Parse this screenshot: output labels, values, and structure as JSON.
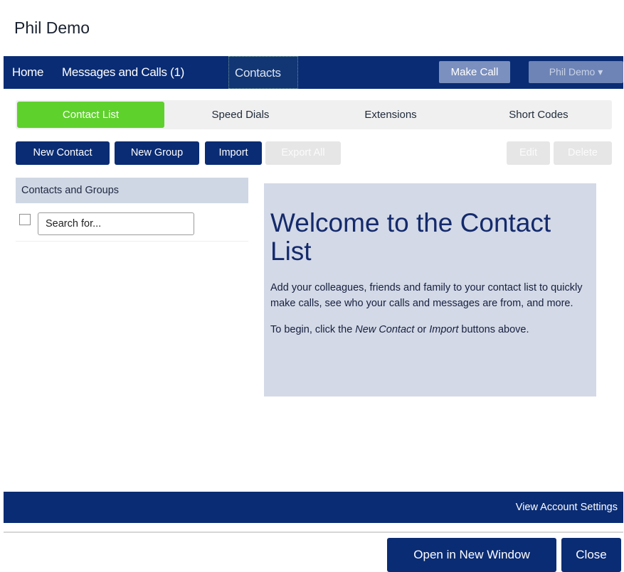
{
  "window": {
    "title": "Phil Demo"
  },
  "navbar": {
    "items": [
      {
        "label": "Home"
      },
      {
        "label": "Messages and Calls (1)"
      },
      {
        "label": "Contacts",
        "active": true
      }
    ],
    "make_call_label": "Make Call",
    "user_menu_label": "Phil Demo ▾"
  },
  "tabs": [
    {
      "label": "Contact List",
      "active": true
    },
    {
      "label": "Speed Dials"
    },
    {
      "label": "Extensions"
    },
    {
      "label": "Short Codes"
    }
  ],
  "toolbar": {
    "new_contact": "New Contact",
    "new_group": "New Group",
    "import": "Import",
    "export_all": "Export All",
    "edit": "Edit",
    "delete": "Delete"
  },
  "contacts_panel": {
    "header": "Contacts and Groups",
    "search_placeholder": "Search for..."
  },
  "welcome": {
    "title": "Welcome to the Contact List",
    "text1": "Add your colleagues, friends and family to your contact list to quickly make calls, see who your calls and messages are from, and more.",
    "text2_before": "To begin, click the ",
    "text2_new_contact": "New Contact",
    "text2_middle": " or ",
    "text2_import": "Import",
    "text2_after": " buttons above."
  },
  "footer": {
    "account_settings": "View Account Settings",
    "open_new_window": "Open in New Window",
    "close": "Close"
  },
  "colors": {
    "primary": "#0a2c74",
    "active_tab": "#5fd12d",
    "panel_bg": "#d3d9e6"
  }
}
